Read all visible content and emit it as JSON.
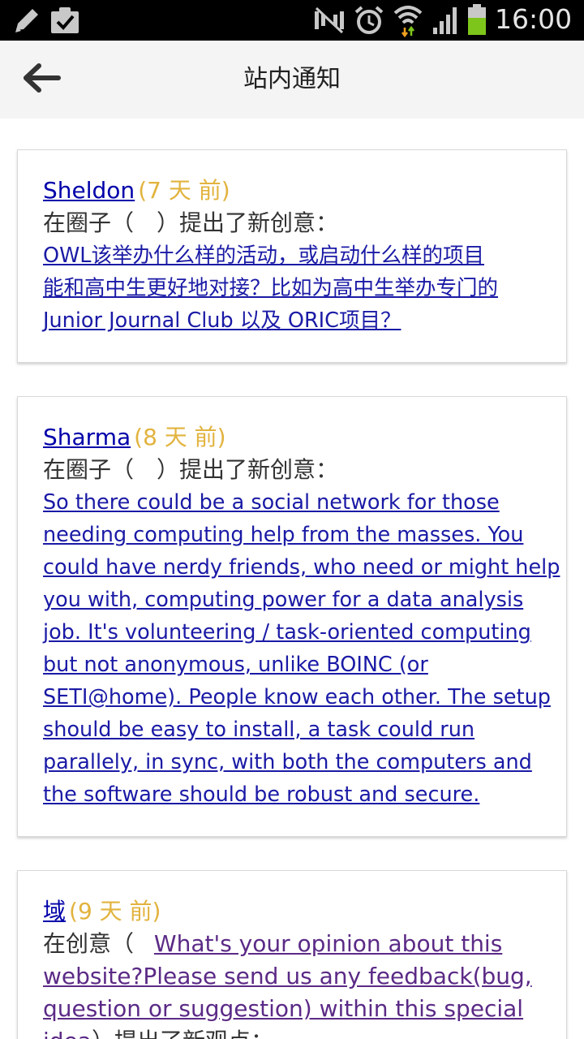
{
  "status_bar": {
    "time": "16:00",
    "colors": {
      "background": "#000000",
      "icons": "#c8c8c8",
      "battery": "#7ec51b"
    },
    "left_icons": [
      "edit-icon",
      "clipboard-check-icon"
    ],
    "right_icons": [
      "mute-icon",
      "alarm-icon",
      "wifi-icon",
      "signal-icon",
      "battery-icon"
    ]
  },
  "header": {
    "title": "站内通知",
    "back_icon": "arrow-left-icon"
  },
  "colors": {
    "author_link": "#0000aa",
    "time": "#e2b33e",
    "content_link": "#1a1aa6",
    "visited_link": "#5b2a86"
  },
  "notifications": [
    {
      "author": "Sheldon",
      "time": "(7 天 前)",
      "action": "在圈子（　）提出了新创意：",
      "content_lines": [
        "OWL该举办什么样的活动，或启动什么样的项目",
        "能和高中生更好地对接？比如为高中生举办专门的",
        "Junior Journal Club 以及 ORIC项目？"
      ]
    },
    {
      "author": "Sharma",
      "time": "(8 天 前)",
      "action": "在圈子（　）提出了新创意：",
      "content_lines": [
        "So there could be a social network for those",
        "needing computing help from the masses. You",
        "could have nerdy friends, who need or might help",
        "you with, computing power for a data analysis",
        "job. It's volunteering / task-oriented computing",
        "but not anonymous, unlike BOINC (or",
        "SETI@home). People know each other. The setup",
        "should be easy to install, a task could run",
        "parallely, in sync, with both the computers and",
        "the software should be robust and secure."
      ]
    },
    {
      "author": "域",
      "time": "(9 天 前)",
      "action_prefix": "在创意（",
      "idea_lines": [
        "What's your opinion about this",
        "website?Please send us any feedback(bug,",
        "question or suggestion) within this special",
        "idea"
      ],
      "action_suffix": "）提出了新观点："
    }
  ]
}
